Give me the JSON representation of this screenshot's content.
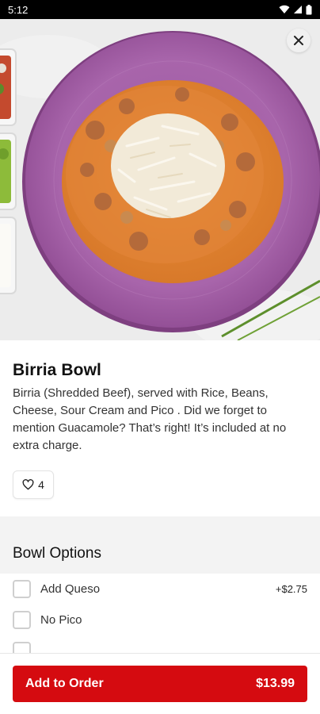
{
  "status_bar": {
    "time": "5:12"
  },
  "hero": {
    "image_subject": "birria bowl on a purple plate",
    "close_icon": "close-icon"
  },
  "item": {
    "title": "Birria Bowl",
    "description": "Birria (Shredded Beef), served with Rice, Beans, Cheese, Sour Cream and Pico . Did we forget to mention Guacamole? That’s right! It’s included at no extra charge.",
    "likes": "4"
  },
  "options_section": {
    "title": "Bowl Options",
    "options": [
      {
        "label": "Add Queso",
        "price": "+$2.75",
        "checked": false
      },
      {
        "label": "No Pico",
        "price": "",
        "checked": false
      }
    ]
  },
  "cart": {
    "add_label": "Add to Order",
    "price": "$13.99"
  },
  "colors": {
    "accent": "#d50b10",
    "plate": "#a45ea6"
  }
}
